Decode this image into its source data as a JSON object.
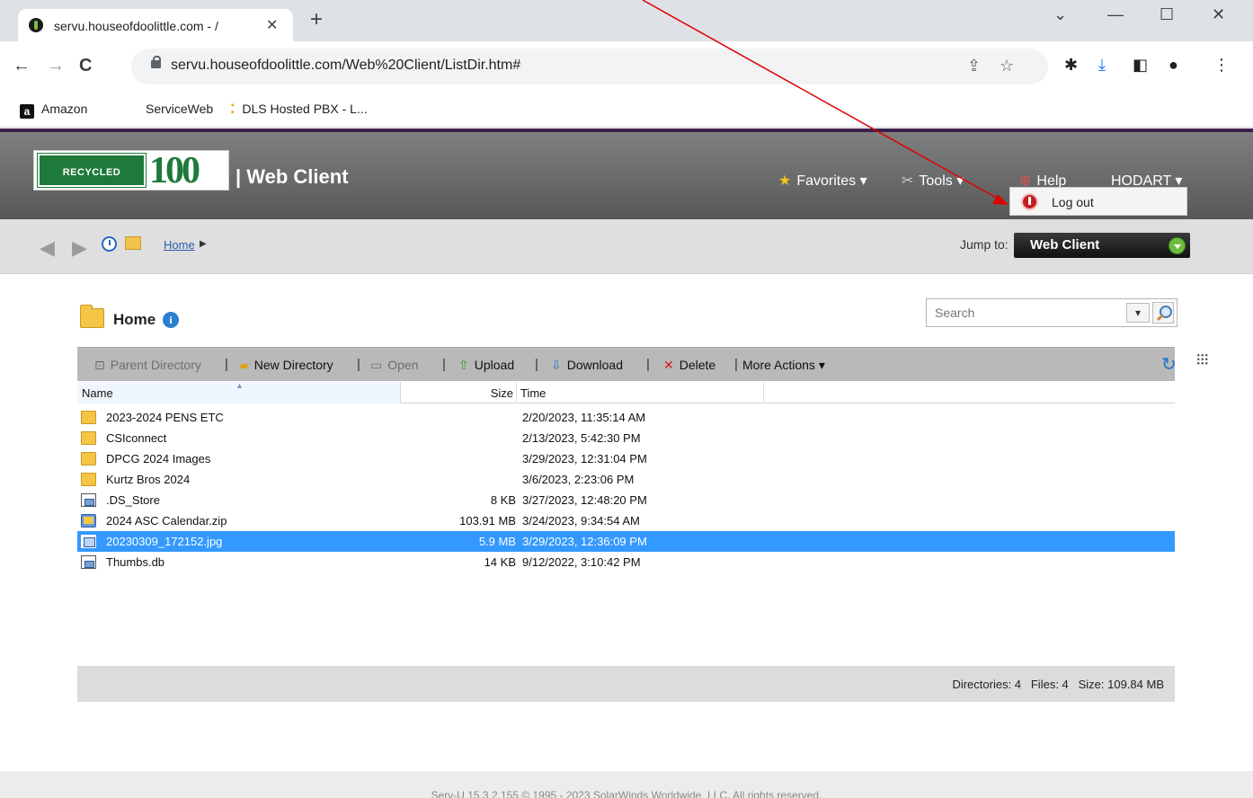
{
  "browser": {
    "tab_title": "servu.houseofdoolittle.com - /",
    "tab_close": "✕",
    "new_tab": "+",
    "url": "servu.houseofdoolittle.com/Web%20Client/ListDir.htm#",
    "window_controls": {
      "chevron": "⌄",
      "minimize": "—",
      "maximize": "☐",
      "close": "✕"
    },
    "nav": {
      "back": "←",
      "forward": "→",
      "reload": "C"
    },
    "bookmarks": [
      {
        "label": "Amazon",
        "icon": "amazon-icon",
        "glyph": "a"
      },
      {
        "label": "ServiceWeb"
      },
      {
        "label": "DLS Hosted PBX - L...",
        "icon": "pbx-icon"
      }
    ]
  },
  "header": {
    "logo_text": "RECYCLED",
    "logo_number": "100",
    "app_title": "| Web Client",
    "menus": {
      "favorites": "Favorites ▾",
      "tools": "Tools ▾",
      "help": "Help",
      "user": "HODART ▾"
    },
    "user_menu": {
      "logout": "Log out"
    }
  },
  "nav": {
    "breadcrumb": "Home",
    "jump_label": "Jump to:",
    "jump_value": "Web Client"
  },
  "main": {
    "title": "Home",
    "search_placeholder": "Search",
    "toolbar": {
      "parent_directory": "Parent Directory",
      "new_directory": "New Directory",
      "open": "Open",
      "upload": "Upload",
      "download": "Download",
      "delete": "Delete",
      "more_actions": "More Actions ▾",
      "separator": "|"
    },
    "columns": {
      "name": "Name",
      "size": "Size",
      "time": "Time"
    },
    "files": [
      {
        "name": "2023-2024 PENS ETC",
        "size": "",
        "time": "2/20/2023, 11:35:14 AM",
        "type": "folder"
      },
      {
        "name": "CSIconnect",
        "size": "",
        "time": "2/13/2023, 5:42:30 PM",
        "type": "folder"
      },
      {
        "name": "DPCG 2024 Images",
        "size": "",
        "time": "3/29/2023, 12:31:04 PM",
        "type": "folder"
      },
      {
        "name": "Kurtz Bros 2024",
        "size": "",
        "time": "3/6/2023, 2:23:06 PM",
        "type": "folder"
      },
      {
        "name": ".DS_Store",
        "size": "8 KB",
        "time": "3/27/2023, 12:48:20 PM",
        "type": "file"
      },
      {
        "name": "2024 ASC Calendar.zip",
        "size": "103.91 MB",
        "time": "3/24/2023, 9:34:54 AM",
        "type": "zip"
      },
      {
        "name": "20230309_172152.jpg",
        "size": "5.9 MB",
        "time": "3/29/2023, 12:36:09 PM",
        "type": "img",
        "selected": true
      },
      {
        "name": "Thumbs.db",
        "size": "14 KB",
        "time": "9/12/2022, 3:10:42 PM",
        "type": "file"
      }
    ],
    "status": "Directories: 4   Files: 4   Size: 109.84 MB"
  },
  "footer": {
    "text": "Serv-U 15.3.2.155 © 1995 - 2023 SolarWinds Worldwide, LLC. All rights reserved."
  },
  "colors": {
    "accent": "#3399ff",
    "header_border": "#3c1f4b",
    "annotation_arrow": "#e00000"
  }
}
